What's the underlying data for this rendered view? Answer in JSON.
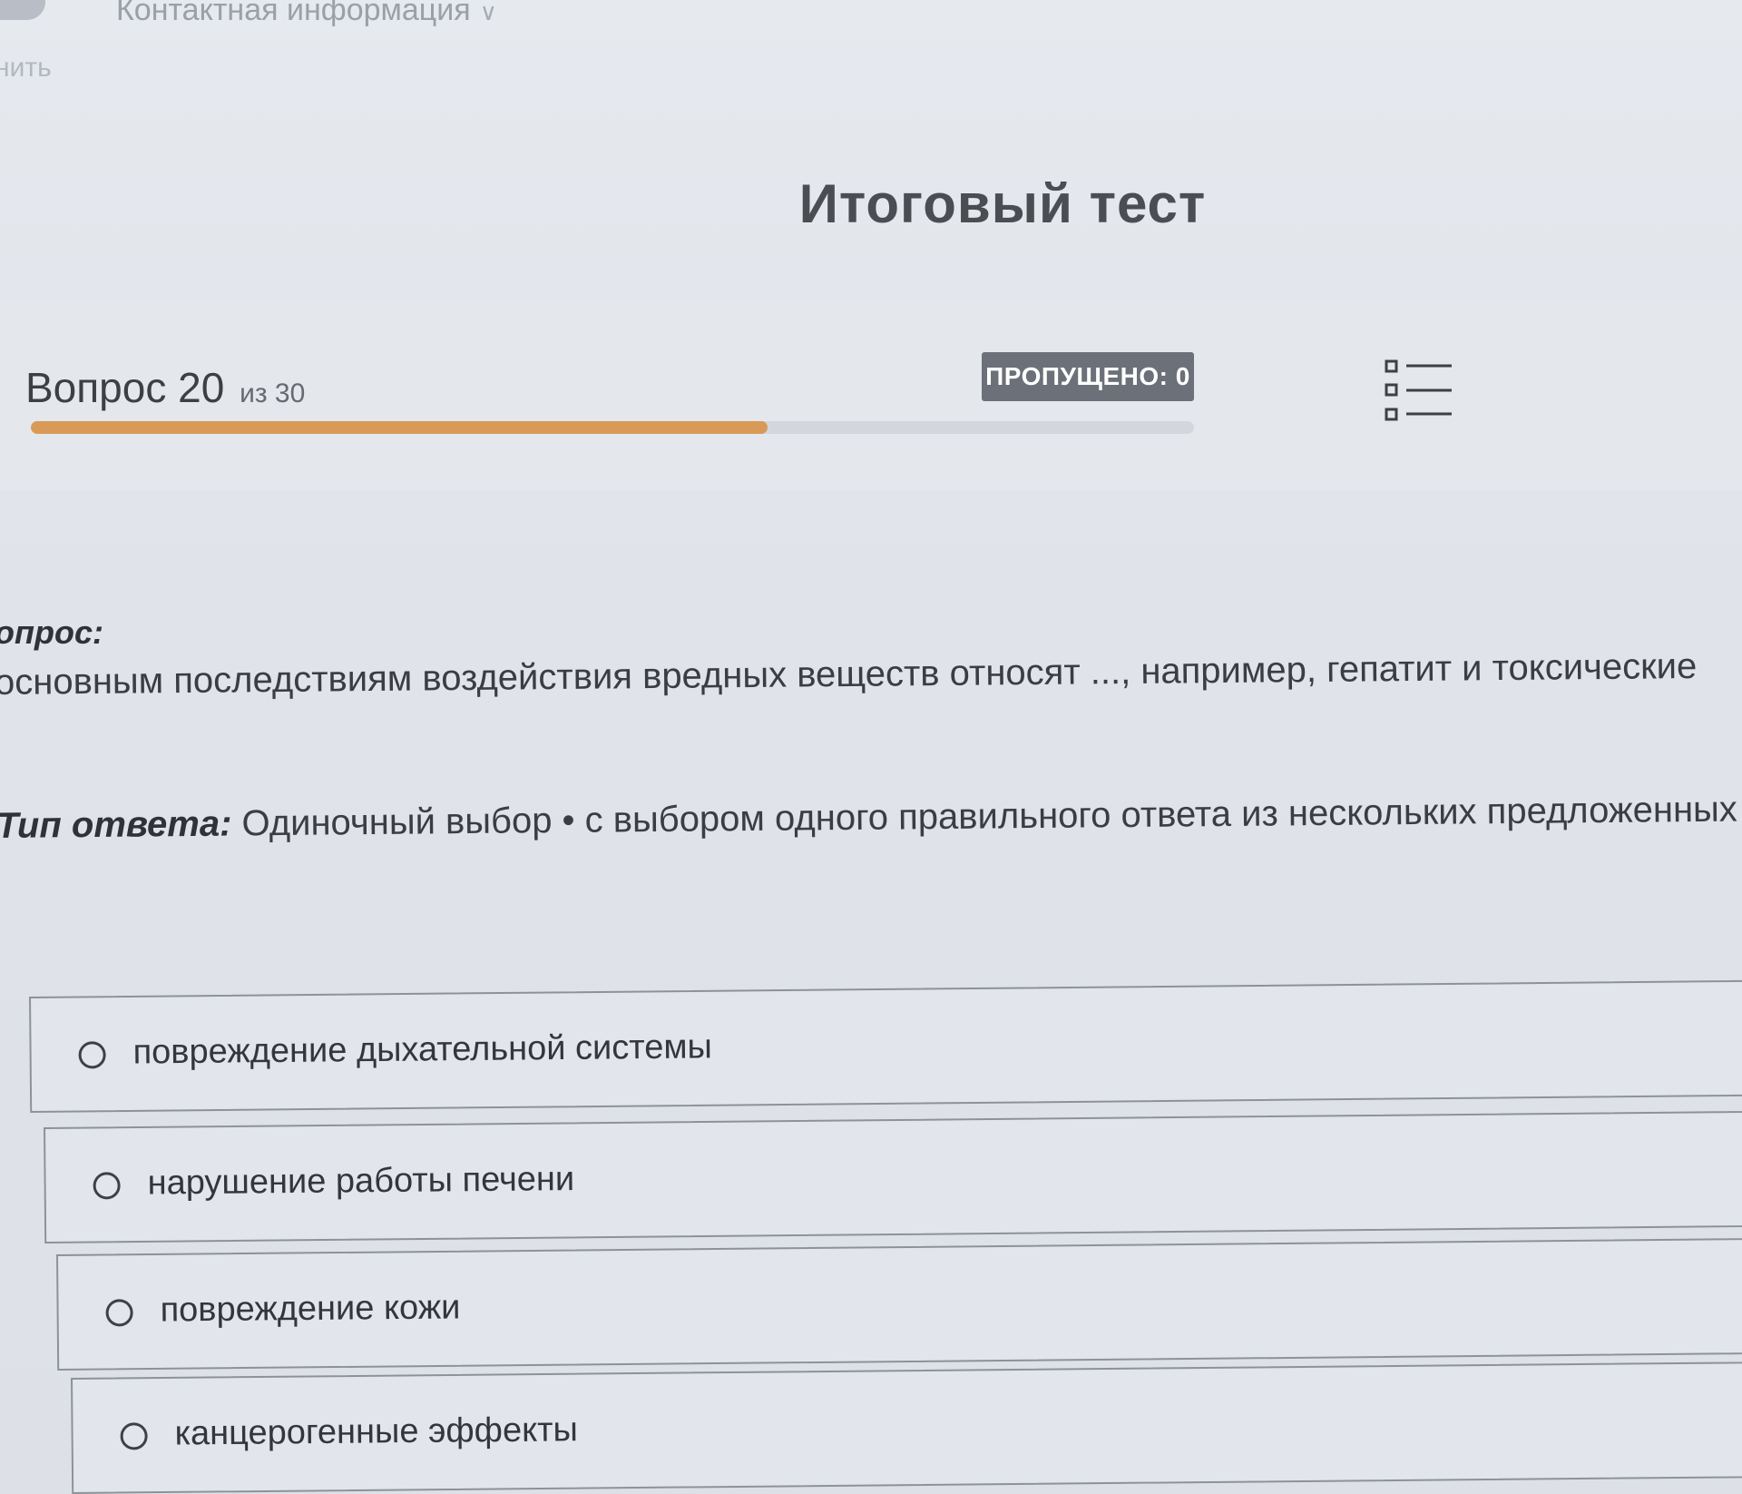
{
  "nav": {
    "contact_info": "Контактная информация",
    "left_link": "нить"
  },
  "page_title": "Итоговый тест",
  "progress": {
    "question_label": "Вопрос 20",
    "of_total": "из 30",
    "current": 20,
    "total": 30,
    "fraction": 0.6333,
    "skipped_label": "ПРОПУЩЕНО: 0",
    "accent_color": "#d99a57"
  },
  "question": {
    "label": "опрос:",
    "text": "основным последствиям воздействия вредных веществ относят ..., например, гепатит и токсические"
  },
  "answer_type": {
    "label": "Тип ответа:",
    "value": "Одиночный выбор • с выбором одного правильного ответа из нескольких предложенных вариан"
  },
  "options": [
    {
      "label": "повреждение дыхательной системы"
    },
    {
      "label": "нарушение работы печени"
    },
    {
      "label": "повреждение кожи"
    },
    {
      "label": "канцерогенные эффекты"
    }
  ],
  "icons": {
    "nav_chevron": "chevron-down-icon",
    "question_list": "question-list-icon",
    "radio": "radio-icon"
  }
}
